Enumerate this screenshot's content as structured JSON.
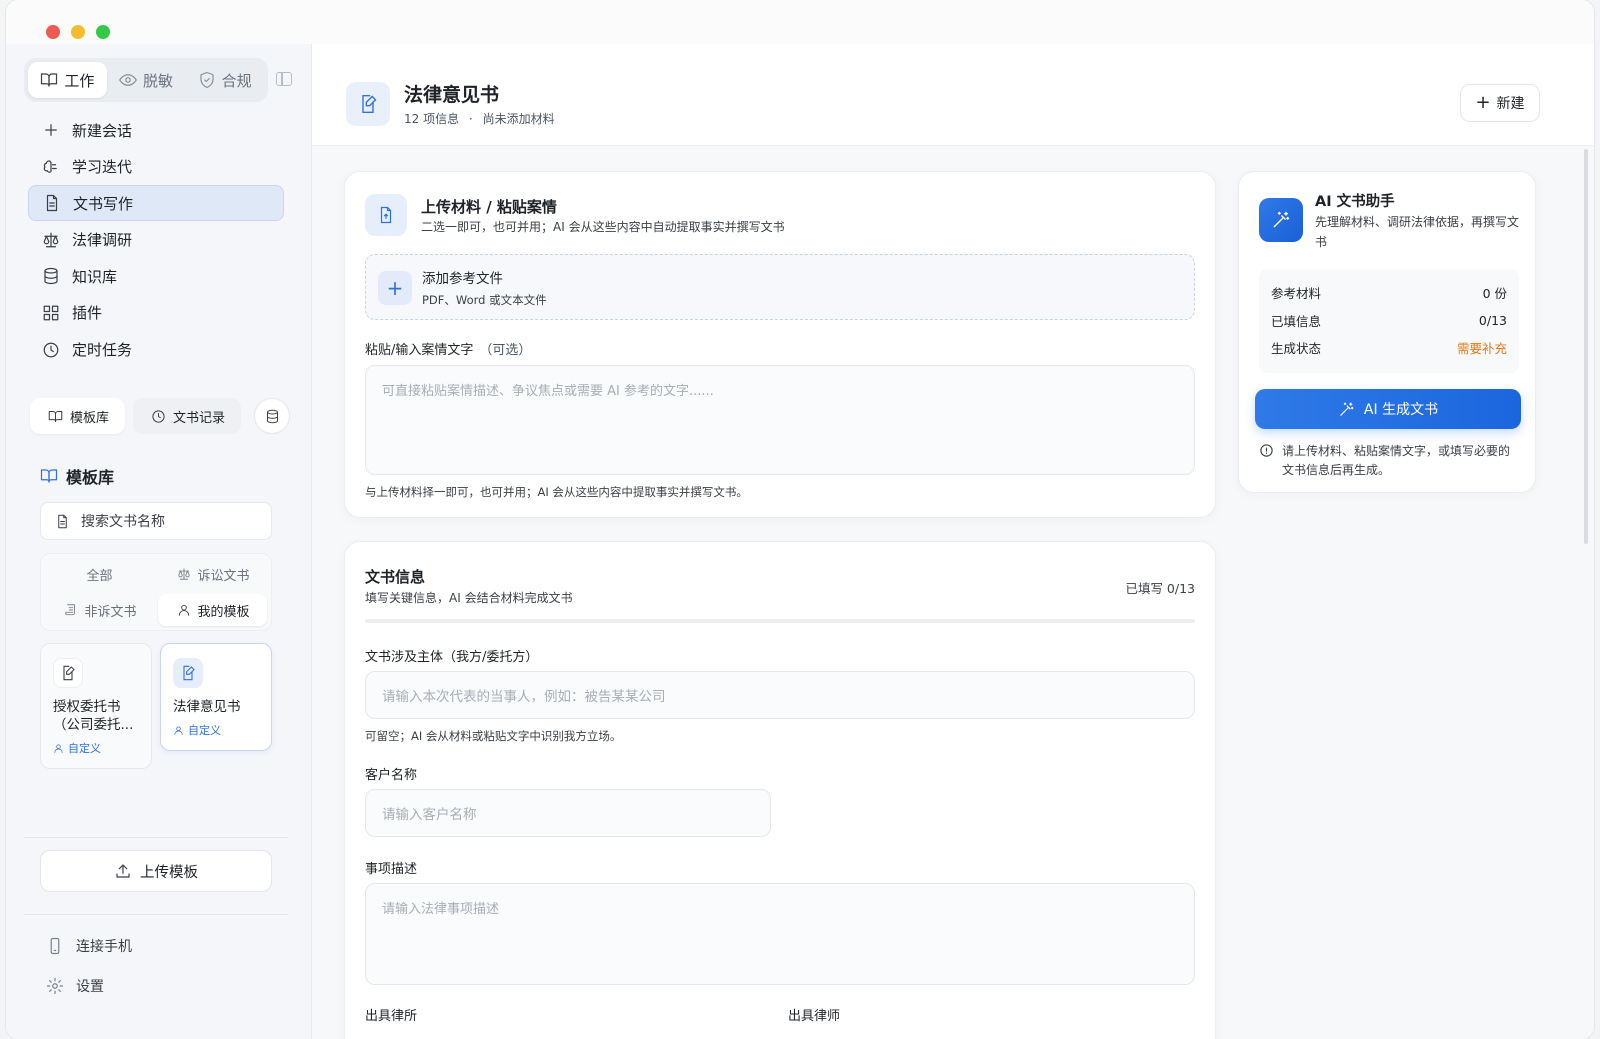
{
  "sidebar": {
    "modes": [
      {
        "label": "工作",
        "icon": "book-open-icon"
      },
      {
        "label": "脱敏",
        "icon": "eye-icon"
      },
      {
        "label": "合规",
        "icon": "shield-icon"
      }
    ],
    "nav": [
      {
        "label": "新建会话",
        "icon": "plus-icon"
      },
      {
        "label": "学习迭代",
        "icon": "brain-icon"
      },
      {
        "label": "文书写作",
        "icon": "document-icon"
      },
      {
        "label": "法律调研",
        "icon": "scale-icon"
      },
      {
        "label": "知识库",
        "icon": "database-icon"
      },
      {
        "label": "插件",
        "icon": "grid-icon"
      },
      {
        "label": "定时任务",
        "icon": "clock-icon"
      }
    ],
    "subtabs": {
      "library": "模板库",
      "records": "文书记录"
    },
    "library_title": "模板库",
    "search_placeholder": "搜索文书名称",
    "filters": [
      "全部",
      "诉讼文书",
      "非诉文书",
      "我的模板"
    ],
    "templates": [
      {
        "title": "授权委托书（公司委托...",
        "tag": "自定义"
      },
      {
        "title": "法律意见书",
        "tag": "自定义"
      }
    ],
    "upload_label": "上传模板",
    "footer": {
      "phone": "连接手机",
      "settings": "设置"
    }
  },
  "header": {
    "title": "法律意见书",
    "info_count": "12 项信息",
    "separator": "·",
    "materials_status": "尚未添加材料",
    "new_label": "新建"
  },
  "upload": {
    "title": "上传材料 / 粘贴案情",
    "subtitle": "二选一即可，也可并用；AI 会从这些内容中自动提取事实并撰写文书",
    "add_file_title": "添加参考文件",
    "add_file_sub": "PDF、Word 或文本文件",
    "paste_label": "粘贴/输入案情文字",
    "paste_optional": "（可选）",
    "paste_placeholder": "可直接粘贴案情描述、争议焦点或需要 AI 参考的文字......",
    "paste_hint": "与上传材料择一即可，也可并用；AI 会从这些内容中提取事实并撰写文书。"
  },
  "doc_info": {
    "title": "文书信息",
    "subtitle": "填写关键信息，AI 会结合材料完成文书",
    "filled": "已填写 0/13",
    "progress": 0,
    "party_label": "文书涉及主体（我方/委托方）",
    "party_placeholder": "请输入本次代表的当事人，例如：被告某某公司",
    "party_hint": "可留空；AI 会从材料或粘贴文字中识别我方立场。",
    "client_label": "客户名称",
    "client_placeholder": "请输入客户名称",
    "matter_label": "事项描述",
    "matter_placeholder": "请输入法律事项描述",
    "firm_label": "出具律所",
    "lawyer_label": "出具律师"
  },
  "assistant": {
    "title": "AI 文书助手",
    "subtitle": "先理解材料、调研法律依据，再撰写文书",
    "stats": [
      {
        "label": "参考材料",
        "value": "0 份"
      },
      {
        "label": "已填信息",
        "value": "0/13"
      },
      {
        "label": "生成状态",
        "value": "需要补充"
      }
    ],
    "generate_label": "AI 生成文书",
    "note": "请上传材料、粘贴案情文字，或填写必要的文书信息后再生成。"
  },
  "colors": {
    "accent": "#2f6fe0",
    "warning": "#e07a17",
    "close": "#ee5a52",
    "minimize": "#f5bd2f",
    "maximize": "#34c748"
  }
}
